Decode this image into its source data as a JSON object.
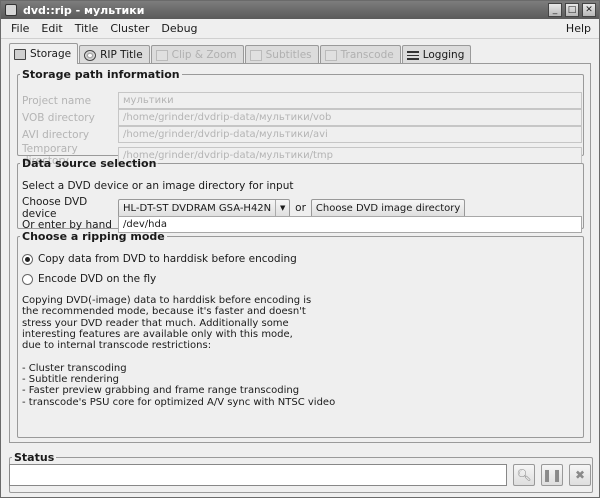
{
  "window": {
    "title": "dvd::rip - мультики"
  },
  "menu": {
    "items": [
      "File",
      "Edit",
      "Title",
      "Cluster",
      "Debug"
    ],
    "help": "Help"
  },
  "tabs": [
    {
      "label": "Storage",
      "icon": "storage-icon",
      "state": "active"
    },
    {
      "label": "RIP Title",
      "icon": "disc-icon",
      "state": "normal"
    },
    {
      "label": "Clip & Zoom",
      "icon": "zoom-icon",
      "state": "disabled"
    },
    {
      "label": "Subtitles",
      "icon": "subtitle-icon",
      "state": "disabled"
    },
    {
      "label": "Transcode",
      "icon": "transcode-icon",
      "state": "disabled"
    },
    {
      "label": "Logging",
      "icon": "log-icon",
      "state": "normal"
    }
  ],
  "storage": {
    "legend": "Storage path information",
    "rows": [
      {
        "label": "Project name",
        "value": "мультики"
      },
      {
        "label": "VOB directory",
        "value": "/home/grinder/dvdrip-data/мультики/vob"
      },
      {
        "label": "AVI directory",
        "value": "/home/grinder/dvdrip-data/мультики/avi"
      },
      {
        "label": "Temporary directory",
        "value": "/home/grinder/dvdrip-data/мультики/tmp"
      }
    ]
  },
  "datasource": {
    "legend": "Data source selection",
    "hint": "Select a DVD device or an image directory for input",
    "device_label": "Choose DVD device",
    "device_value": "HL-DT-ST DVDRAM GSA-H42N",
    "or": "or",
    "image_button": "Choose DVD image directory",
    "hand_label": "Or enter by hand",
    "hand_value": "/dev/hda"
  },
  "ripmode": {
    "legend": "Choose a ripping mode",
    "option1": "Copy data from DVD to harddisk before encoding",
    "option2": "Encode DVD on the fly",
    "selected": 1,
    "description": "Copying DVD(-image) data to harddisk before encoding is\nthe recommended mode, because it's faster and doesn't\nstress your DVD reader that much. Additionally some\ninteresting features are available only with this mode,\ndue to internal transcode restrictions:\n\n- Cluster transcoding\n- Subtitle rendering\n- Faster preview grabbing and frame range transcoding\n- transcode's PSU core for optimized A/V sync with NTSC video"
  },
  "status": {
    "legend": "Status",
    "text": ""
  }
}
